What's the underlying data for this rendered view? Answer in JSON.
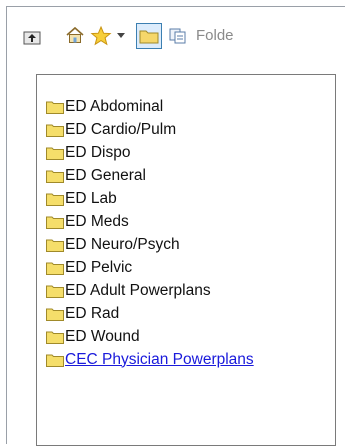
{
  "toolbar": {
    "label": "Folde",
    "icons": [
      "folder-up-icon",
      "home-icon",
      "star-icon",
      "dropdown-arrow-icon",
      "folder-view-icon",
      "copy-icon"
    ]
  },
  "folders": [
    {
      "label": "ED Abdominal"
    },
    {
      "label": "ED Cardio/Pulm"
    },
    {
      "label": "ED Dispo"
    },
    {
      "label": "ED General"
    },
    {
      "label": "ED Lab"
    },
    {
      "label": "ED Meds"
    },
    {
      "label": "ED Neuro/Psych"
    },
    {
      "label": "ED Pelvic"
    },
    {
      "label": "ED Adult Powerplans"
    },
    {
      "label": "ED Rad"
    },
    {
      "label": "ED Wound"
    },
    {
      "label": "CEC Physician Powerplans",
      "link": true
    }
  ],
  "colors": {
    "folder": "#f5de6a",
    "folder_outline": "#a08a2a",
    "link": "#1a1adb"
  }
}
